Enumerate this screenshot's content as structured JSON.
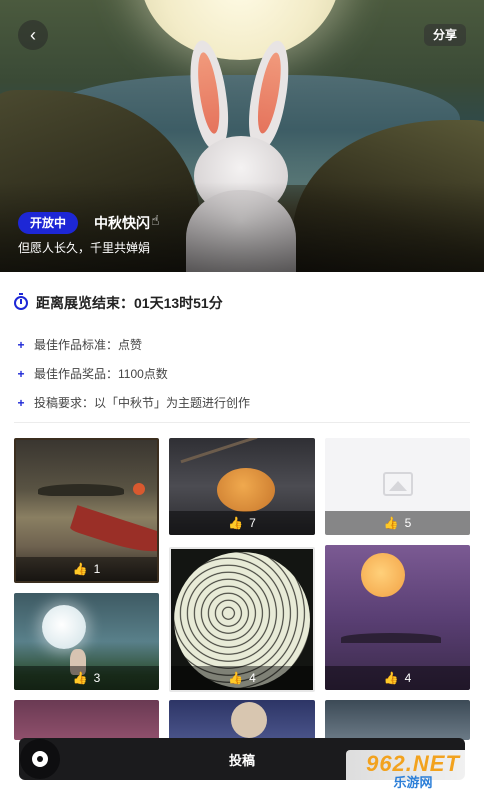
{
  "hero": {
    "share_label": "分享",
    "status_badge": "开放中",
    "title": "中秋快闪",
    "subtitle": "但愿人长久，千里共婵娟"
  },
  "countdown": {
    "text": "距离展览结束：01天13时51分"
  },
  "rules": [
    {
      "text": "最佳作品标准：点赞"
    },
    {
      "text": "最佳作品奖品：1100点数"
    },
    {
      "text": "投稿要求：以「中秋节」为主题进行创作"
    }
  ],
  "gallery": [
    {
      "likes": "1"
    },
    {
      "likes": "7"
    },
    {
      "likes": "5"
    },
    {
      "likes": "3"
    },
    {
      "likes": "4"
    },
    {
      "likes": "4"
    }
  ],
  "footer": {
    "submit_label": "投稿"
  },
  "watermark": {
    "top": "962.NET",
    "bottom": "乐游网"
  },
  "colors": {
    "accent": "#1d27d6",
    "submit_bg": "#1b1b1d"
  }
}
